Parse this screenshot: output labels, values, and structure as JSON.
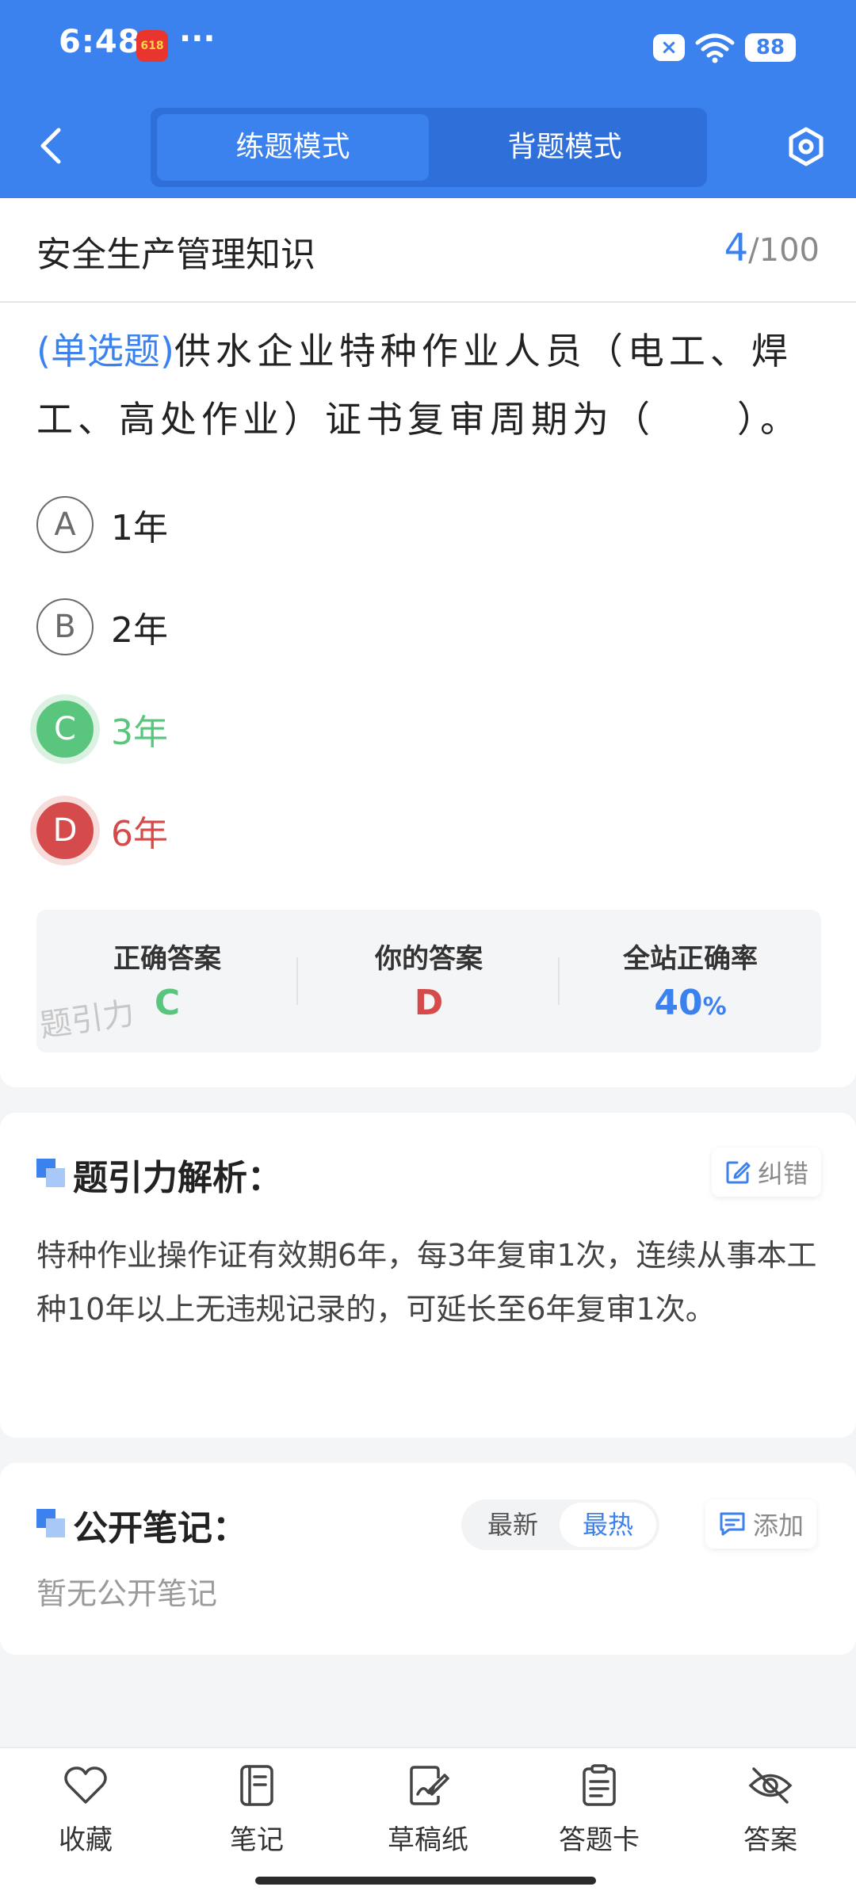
{
  "status_bar": {
    "time": "6:48",
    "app_badge": "618",
    "overflow": "···",
    "battery": "88"
  },
  "header": {
    "modes": [
      "练题模式",
      "背题模式"
    ],
    "active_mode": "练题模式"
  },
  "subject": {
    "title": "安全生产管理知识",
    "current": "4",
    "separator": "/",
    "total": "100"
  },
  "question": {
    "type": "(单选题)",
    "text": "供水企业特种作业人员（电工、焊工、高处作业）证书复审周期为（　　）。",
    "options": [
      {
        "key": "A",
        "text": "1年",
        "state": "normal"
      },
      {
        "key": "B",
        "text": "2年",
        "state": "normal"
      },
      {
        "key": "C",
        "text": "3年",
        "state": "correct"
      },
      {
        "key": "D",
        "text": "6年",
        "state": "wrong"
      }
    ]
  },
  "answer_summary": {
    "correct_label": "正确答案",
    "correct_value": "C",
    "yours_label": "你的答案",
    "yours_value": "D",
    "rate_label": "全站正确率",
    "rate_value": "40",
    "rate_unit": "%",
    "watermark": "题引力"
  },
  "analysis": {
    "title": "题引力解析：",
    "report_label": "纠错",
    "text": "特种作业操作证有效期6年，每3年复审1次，连续从事本工种10年以上无违规记录的，可延长至6年复审1次。"
  },
  "notes": {
    "title": "公开笔记：",
    "sort_new": "最新",
    "sort_hot": "最热",
    "add_label": "添加",
    "empty_text": "暂无公开笔记"
  },
  "bottom_nav": {
    "items": [
      {
        "label": "收藏",
        "icon": "heart-icon"
      },
      {
        "label": "笔记",
        "icon": "notebook-icon"
      },
      {
        "label": "草稿纸",
        "icon": "draft-icon"
      },
      {
        "label": "答题卡",
        "icon": "answer-card-icon"
      },
      {
        "label": "答案",
        "icon": "eye-off-icon"
      }
    ]
  },
  "colors": {
    "primary": "#3c82ee",
    "correct": "#5ac67d",
    "wrong": "#d54b4b"
  }
}
